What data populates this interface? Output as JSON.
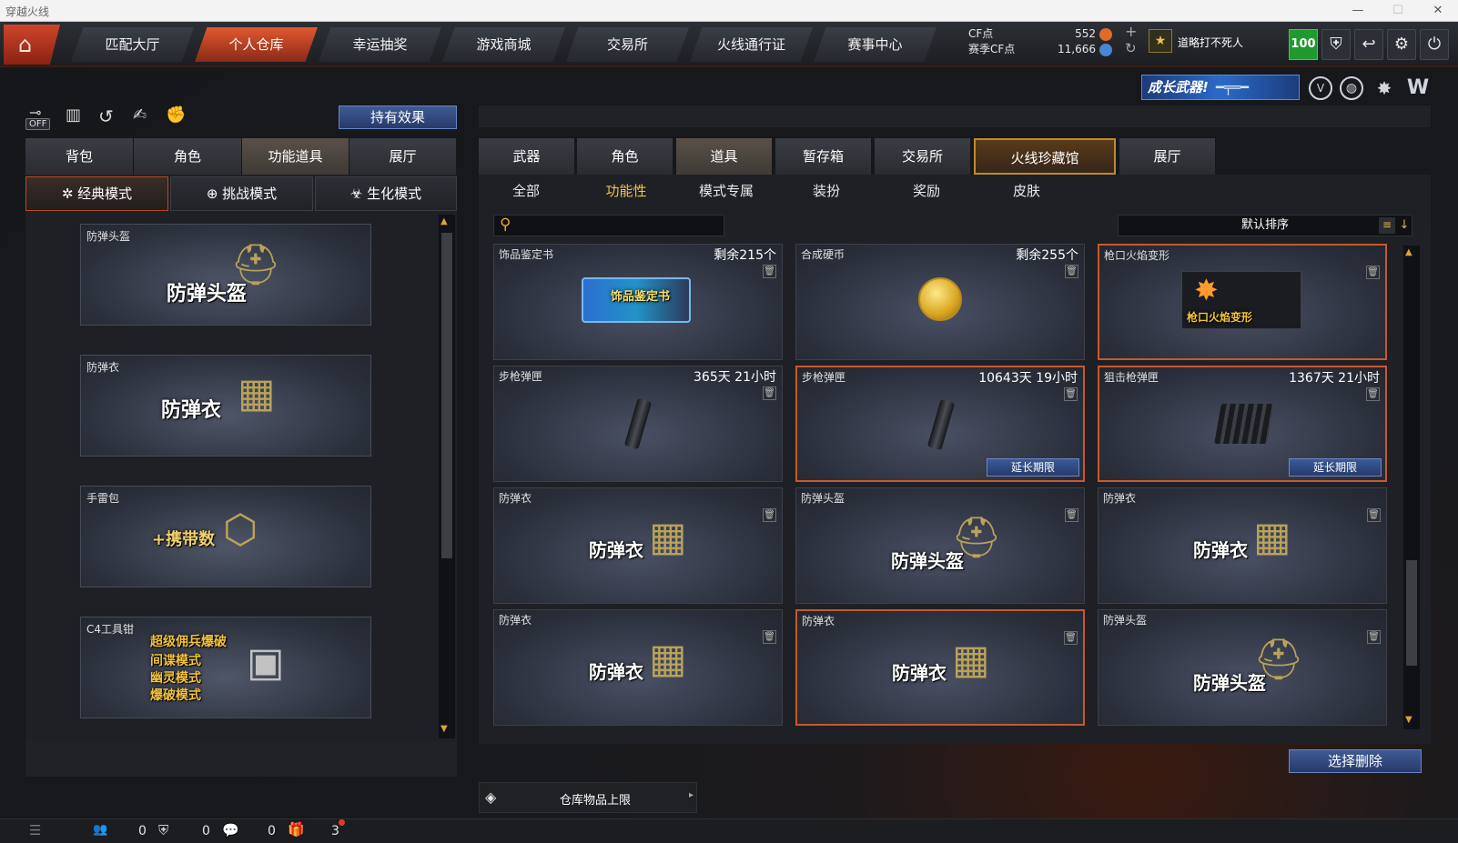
{
  "window": {
    "title": "穿越火线",
    "controls": [
      "—",
      "☐",
      "✕"
    ]
  },
  "topnav": {
    "home_icon": "home-icon",
    "tabs": [
      "匹配大厅",
      "个人仓库",
      "幸运抽奖",
      "游戏商城",
      "交易所",
      "火线通行证",
      "赛事中心"
    ],
    "active_tab": "个人仓库",
    "cf_label": "CF点",
    "cf_value": "552",
    "season_label": "赛季CF点",
    "season_value": "11,666",
    "plus": "+",
    "refresh": "↻",
    "username": "道略打不死人",
    "level": "100",
    "colors": {
      "accent": "#d24a28",
      "level_bg": "#1f9a2e"
    }
  },
  "banner": {
    "text": "成长武器!"
  },
  "left": {
    "icons": [
      "off-toggle-icon",
      "ranking-icon",
      "history-icon",
      "hand-icon",
      "glove-icon"
    ],
    "off_label": "OFF",
    "effects_button": "持有效果",
    "tabs": [
      "背包",
      "角色",
      "功能道具",
      "展厅"
    ],
    "active_tab": "功能道具",
    "modes": [
      "经典模式",
      "挑战模式",
      "生化模式"
    ],
    "active_mode": "经典模式",
    "items": [
      {
        "name": "防弹头盔",
        "art_text": "防弹头盔"
      },
      {
        "name": "防弹衣",
        "art_text": "防弹衣"
      },
      {
        "name": "手雷包",
        "art_text": "+携带数"
      },
      {
        "name": "C4工具钳",
        "art_lines": [
          "超级佣兵爆破",
          "间谍模式",
          "幽灵模式",
          "爆破模式"
        ]
      }
    ]
  },
  "right": {
    "tabs": [
      "武器",
      "角色",
      "道具",
      "暂存箱",
      "交易所",
      "火线珍藏馆",
      "展厅"
    ],
    "active_tab": "道具",
    "special_tab": "火线珍藏馆",
    "subtabs": [
      "全部",
      "功能性",
      "模式专属",
      "装扮",
      "奖励",
      "皮肤"
    ],
    "active_subtab": "功能性",
    "search_placeholder": "",
    "sort_label": "默认排序",
    "cards": [
      {
        "name": "饰品鉴定书",
        "right": "剩余215个",
        "art": "饰品鉴定书",
        "extend": "",
        "hl": false
      },
      {
        "name": "合成硬币",
        "right": "剩余255个",
        "art": "",
        "extend": "",
        "hl": false
      },
      {
        "name": "枪口火焰变形",
        "right": "",
        "art": "枪口火焰变形",
        "extend": "",
        "hl": true
      },
      {
        "name": "步枪弹匣",
        "right": "365天 21小时",
        "art": "",
        "extend": "",
        "hl": false
      },
      {
        "name": "步枪弹匣",
        "right": "10643天 19小时",
        "art": "",
        "extend": "延长期限",
        "hl": true
      },
      {
        "name": "狙击枪弹匣",
        "right": "1367天 21小时",
        "art": "",
        "extend": "延长期限",
        "hl": true
      },
      {
        "name": "防弹衣",
        "right": "",
        "art": "防弹衣",
        "extend": "",
        "hl": false
      },
      {
        "name": "防弹头盔",
        "right": "",
        "art": "防弹头盔",
        "extend": "",
        "hl": false
      },
      {
        "name": "防弹衣",
        "right": "",
        "art": "防弹衣",
        "extend": "",
        "hl": false
      },
      {
        "name": "防弹衣",
        "right": "",
        "art": "防弹衣",
        "extend": "",
        "hl": false
      },
      {
        "name": "防弹衣",
        "right": "",
        "art": "防弹衣",
        "extend": "",
        "hl": true
      },
      {
        "name": "防弹头盔",
        "right": "",
        "art": "防弹头盔",
        "extend": "",
        "hl": false
      }
    ],
    "delete_button": "选择删除",
    "storage_label": "仓库物品上限"
  },
  "statusbar": {
    "counts": [
      "0",
      "0",
      "0",
      "3"
    ]
  }
}
